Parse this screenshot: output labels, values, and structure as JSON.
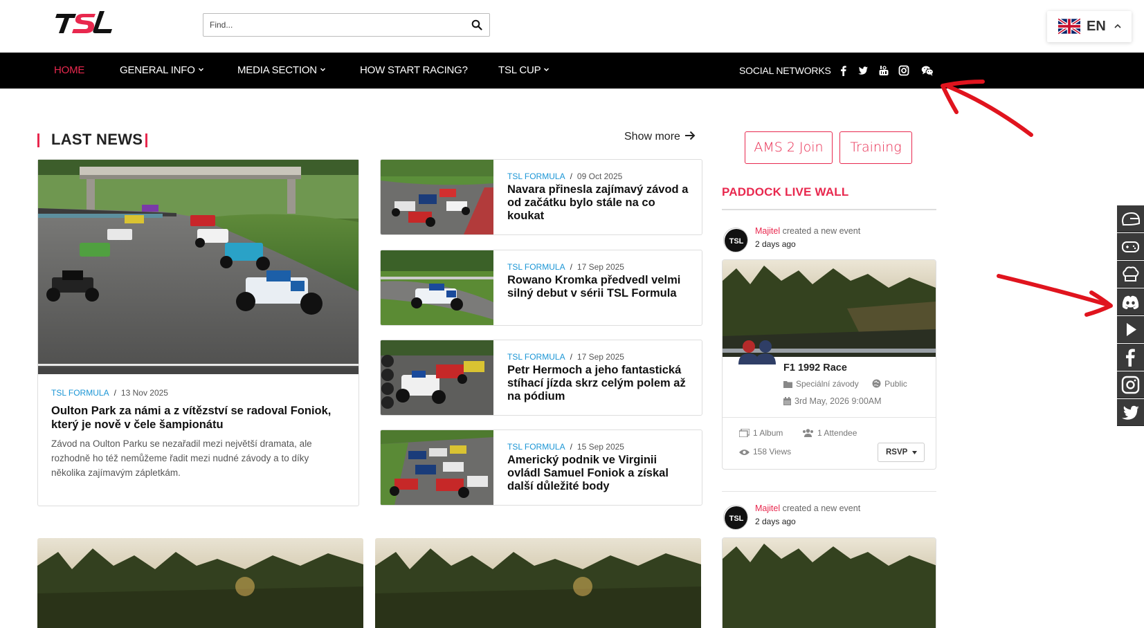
{
  "header": {
    "logo_text": "TSL",
    "search": {
      "placeholder": "Find...",
      "value": ""
    },
    "language": {
      "code": "EN"
    }
  },
  "nav": {
    "items": [
      {
        "label": "HOME",
        "active": true,
        "dropdown": false
      },
      {
        "label": "GENERAL INFO",
        "active": false,
        "dropdown": true
      },
      {
        "label": "MEDIA SECTION",
        "active": false,
        "dropdown": true
      },
      {
        "label": "HOW START RACING?",
        "active": false,
        "dropdown": false
      },
      {
        "label": "TSL CUP",
        "active": false,
        "dropdown": true
      }
    ],
    "social_label": "SOCIAL NETWORKS",
    "social_icons": [
      "facebook-icon",
      "twitter-icon",
      "youtube-icon",
      "instagram-icon",
      "wechat-icon"
    ]
  },
  "news": {
    "section_title": "LAST NEWS",
    "show_more": "Show more",
    "featured": {
      "category": "TSL FORMULA",
      "date": "13 Nov 2025",
      "title": "Oulton Park za námi a z vítězství se radoval Foniok, který je nově v čele šampionátu",
      "excerpt": "Závod na Oulton Parku se nezařadil mezi největší dramata, ale rozhodně ho též nemůžeme řadit mezi nudné závody a to díky několika zajímavým zápletkám."
    },
    "articles": [
      {
        "category": "TSL FORMULA",
        "date": "09 Oct 2025",
        "title": "Navara přinesla zajímavý závod a od začátku bylo stále na co koukat"
      },
      {
        "category": "TSL FORMULA",
        "date": "17 Sep 2025",
        "title": "Rowano Kromka předvedl velmi silný debut v sérii TSL Formula"
      },
      {
        "category": "TSL FORMULA",
        "date": "17 Sep 2025",
        "title": "Petr Hermoch a jeho fantastická stíhací jízda skrz celým polem až na pódium"
      },
      {
        "category": "TSL FORMULA",
        "date": "15 Sep 2025",
        "title": "Americký podnik ve Virginii ovládl Samuel Foniok a získal další důležité body"
      }
    ]
  },
  "sidebar": {
    "buttons": [
      "AMS 2 Join",
      "Training"
    ],
    "wall_title": "PADDOCK LIVE WALL",
    "posts": [
      {
        "author": "Majitel",
        "action": " created a new event",
        "time": "2 days ago",
        "event": {
          "title": "F1 1992 Race",
          "category": "Speciální závody",
          "privacy": "Public",
          "datetime": "3rd May, 2026 9:00AM",
          "albums": "1 Album",
          "attendees": "1 Attendee",
          "views": "158 Views",
          "rsvp": "RSVP"
        }
      },
      {
        "author": "Majitel",
        "action": " created a new event",
        "time": "2 days ago"
      }
    ]
  },
  "floating_bar": [
    "helmet-icon",
    "gamepad-icon",
    "chef-hat-icon",
    "discord-icon",
    "play-icon",
    "facebook-icon",
    "instagram-icon",
    "twitter-icon"
  ],
  "colors": {
    "accent": "#e8284e",
    "category": "#1a95d5",
    "nav_bg": "#000000",
    "annotation": "#e0141e"
  }
}
